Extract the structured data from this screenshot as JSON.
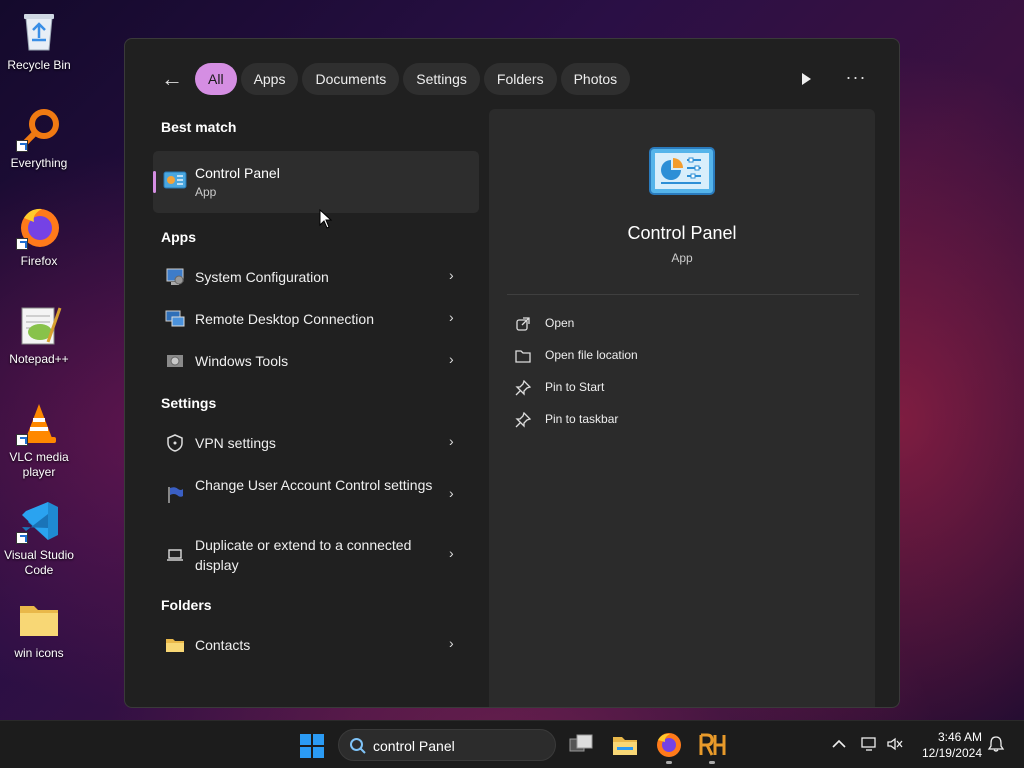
{
  "desktop": {
    "icons": [
      {
        "label": "Recycle Bin",
        "icon": "recycle-bin-icon"
      },
      {
        "label": "Everything",
        "icon": "everything-search-icon"
      },
      {
        "label": "Firefox",
        "icon": "firefox-icon"
      },
      {
        "label": "Notepad++",
        "icon": "notepad-plus-plus-icon"
      },
      {
        "label": "VLC media player",
        "icon": "vlc-icon"
      },
      {
        "label": "Visual Studio Code",
        "icon": "vscode-icon"
      },
      {
        "label": "win icons",
        "icon": "folder-icon"
      }
    ]
  },
  "menu": {
    "filters": [
      "All",
      "Apps",
      "Documents",
      "Settings",
      "Folders",
      "Photos"
    ],
    "active_filter": "All",
    "best_match": {
      "heading": "Best match",
      "title": "Control Panel",
      "subtitle": "App"
    },
    "apps": {
      "heading": "Apps",
      "items": [
        "System Configuration",
        "Remote Desktop Connection",
        "Windows Tools"
      ]
    },
    "settings": {
      "heading": "Settings",
      "items": [
        "VPN settings",
        "Change User Account Control settings",
        "Duplicate or extend to a connected display"
      ]
    },
    "folders": {
      "heading": "Folders",
      "items": [
        "Contacts"
      ]
    },
    "preview": {
      "title": "Control Panel",
      "subtitle": "App",
      "actions": [
        "Open",
        "Open file location",
        "Pin to Start",
        "Pin to taskbar"
      ]
    },
    "chevron": "›",
    "more": "···",
    "back": "←"
  },
  "taskbar": {
    "search_value": "control Panel",
    "time": "3:46 AM",
    "date": "12/19/2024",
    "colors": {
      "accent": "#d58ee3",
      "win_blue": "#2b9bf4"
    }
  }
}
